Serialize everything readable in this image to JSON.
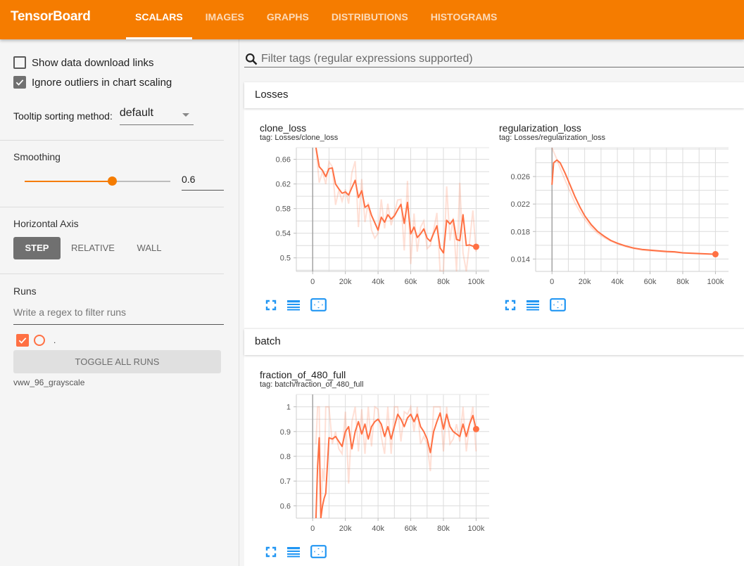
{
  "header": {
    "brand": "TensorBoard",
    "tabs": [
      {
        "label": "SCALARS",
        "active": true
      },
      {
        "label": "IMAGES",
        "active": false
      },
      {
        "label": "GRAPHS",
        "active": false
      },
      {
        "label": "DISTRIBUTIONS",
        "active": false
      },
      {
        "label": "HISTOGRAMS",
        "active": false
      }
    ]
  },
  "sidebar": {
    "show_download_links": {
      "label": "Show data download links",
      "checked": false
    },
    "ignore_outliers": {
      "label": "Ignore outliers in chart scaling",
      "checked": true
    },
    "tooltip_sorting": {
      "label": "Tooltip sorting method:",
      "value": "default"
    },
    "smoothing": {
      "label": "Smoothing",
      "value": "0.6",
      "fraction": 0.6
    },
    "horizontal_axis": {
      "label": "Horizontal Axis",
      "options": [
        {
          "label": "STEP",
          "active": true
        },
        {
          "label": "RELATIVE",
          "active": false
        },
        {
          "label": "WALL",
          "active": false
        }
      ]
    },
    "runs": {
      "label": "Runs",
      "filter_placeholder": "Write a regex to filter runs",
      "items": [
        {
          "name": ".",
          "checked": true,
          "color": "#ff7043"
        }
      ],
      "toggle_all_label": "TOGGLE ALL RUNS",
      "log_dir": "vww_96_grayscale"
    }
  },
  "main": {
    "filter_placeholder": "Filter tags (regular expressions supported)",
    "groups": [
      {
        "name": "Losses"
      },
      {
        "name": "batch"
      }
    ],
    "icons": [
      "fit-to-screen-icon",
      "data-series-list-icon",
      "zoom-reset-icon"
    ]
  },
  "colors": {
    "accent": "#f57c00",
    "run": "#ff7043",
    "icon_blue": "#2196f3"
  },
  "chart_data": [
    {
      "type": "line",
      "title": "clone_loss",
      "tag": "tag: Losses/clone_loss",
      "xlabel": "",
      "ylabel": "",
      "xlim": [
        -10000,
        108000
      ],
      "ylim": [
        0.478,
        0.679
      ],
      "xticks": [
        0,
        20000,
        40000,
        60000,
        80000,
        100000
      ],
      "xtick_labels": [
        "0",
        "20k",
        "40k",
        "60k",
        "80k",
        "100k"
      ],
      "yticks": [
        0.5,
        0.54,
        0.58,
        0.62,
        0.66
      ],
      "ytick_labels": [
        "0.5",
        "0.54",
        "0.58",
        "0.62",
        "0.66"
      ],
      "x_grid_step": 10000,
      "y_grid_step": 0.02,
      "grid": true,
      "series": [
        {
          "name": ".",
          "smoothed": true,
          "x": [
            2000,
            4000,
            6000,
            8000,
            10000,
            12000,
            14000,
            16000,
            18000,
            20000,
            22000,
            24000,
            26000,
            28000,
            30000,
            32000,
            34000,
            36000,
            38000,
            40000,
            42000,
            44000,
            46000,
            48000,
            50000,
            52000,
            54000,
            56000,
            58000,
            60000,
            62000,
            64000,
            66000,
            68000,
            70000,
            72000,
            74000,
            76000,
            78000,
            80000,
            82000,
            84000,
            86000,
            88000,
            90000,
            92000,
            94000,
            96000,
            98000,
            100000
          ],
          "values": [
            0.679,
            0.648,
            0.642,
            0.632,
            0.645,
            0.646,
            0.62,
            0.612,
            0.605,
            0.607,
            0.602,
            0.614,
            0.626,
            0.598,
            0.609,
            0.582,
            0.586,
            0.569,
            0.557,
            0.545,
            0.566,
            0.558,
            0.57,
            0.563,
            0.568,
            0.578,
            0.587,
            0.556,
            0.59,
            0.539,
            0.55,
            0.533,
            0.539,
            0.547,
            0.532,
            0.527,
            0.54,
            0.552,
            0.516,
            0.508,
            0.561,
            0.555,
            0.562,
            0.53,
            0.528,
            0.57,
            0.52,
            0.521,
            0.519,
            0.518
          ]
        },
        {
          "name": ". (raw)",
          "smoothed": false,
          "x": [
            2000,
            4000,
            6000,
            8000,
            10000,
            12000,
            14000,
            16000,
            18000,
            20000,
            22000,
            24000,
            26000,
            28000,
            30000,
            32000,
            34000,
            36000,
            38000,
            40000,
            42000,
            44000,
            46000,
            48000,
            50000,
            52000,
            54000,
            56000,
            58000,
            60000,
            62000,
            64000,
            66000,
            68000,
            70000,
            72000,
            74000,
            76000,
            78000,
            80000,
            82000,
            84000,
            86000,
            88000,
            90000,
            92000,
            94000,
            96000,
            98000,
            100000
          ],
          "values": [
            0.679,
            0.622,
            0.64,
            0.62,
            0.656,
            0.648,
            0.586,
            0.61,
            0.592,
            0.611,
            0.588,
            0.638,
            0.657,
            0.55,
            0.628,
            0.558,
            0.59,
            0.545,
            0.532,
            0.54,
            0.595,
            0.548,
            0.588,
            0.553,
            0.573,
            0.594,
            0.595,
            0.512,
            0.625,
            0.49,
            0.572,
            0.51,
            0.55,
            0.56,
            0.515,
            0.52,
            0.545,
            0.573,
            0.478,
            0.478,
            0.616,
            0.528,
            0.565,
            0.478,
            0.622,
            0.508,
            0.478,
            0.525,
            0.577,
            0.51
          ]
        }
      ]
    },
    {
      "type": "line",
      "title": "regularization_loss",
      "tag": "tag: Losses/regularization_loss",
      "xlabel": "",
      "ylabel": "",
      "xlim": [
        -10000,
        108000
      ],
      "ylim": [
        0.0122,
        0.0302
      ],
      "xticks": [
        0,
        20000,
        40000,
        60000,
        80000,
        100000
      ],
      "xtick_labels": [
        "0",
        "20k",
        "40k",
        "60k",
        "80k",
        "100k"
      ],
      "yticks": [
        0.014,
        0.018,
        0.022,
        0.026
      ],
      "ytick_labels": [
        "0.014",
        "0.018",
        "0.022",
        "0.026"
      ],
      "x_grid_step": 10000,
      "y_grid_step": 0.002,
      "grid": true,
      "series": [
        {
          "name": ".",
          "smoothed": true,
          "x": [
            0,
            1000,
            3000,
            5000,
            8000,
            11000,
            14000,
            17000,
            20000,
            24000,
            28000,
            32000,
            36000,
            40000,
            45000,
            50000,
            55000,
            60000,
            65000,
            70000,
            75000,
            80000,
            85000,
            90000,
            95000,
            100000
          ],
          "values": [
            0.0248,
            0.028,
            0.0284,
            0.028,
            0.0265,
            0.0248,
            0.0231,
            0.0216,
            0.0203,
            0.019,
            0.018,
            0.0173,
            0.0167,
            0.0163,
            0.0159,
            0.0156,
            0.0154,
            0.0153,
            0.0152,
            0.0151,
            0.01505,
            0.0149,
            0.01485,
            0.0148,
            0.01475,
            0.0147
          ]
        },
        {
          "name": ". (raw)",
          "smoothed": false,
          "x": [
            0,
            1000,
            3000,
            5000,
            8000,
            11000,
            14000,
            17000,
            20000,
            24000,
            28000,
            32000,
            36000,
            40000,
            45000,
            50000,
            55000,
            60000,
            65000,
            70000,
            75000,
            80000,
            85000,
            90000,
            95000,
            100000
          ],
          "values": [
            0.0302,
            0.0296,
            0.0285,
            0.0272,
            0.0255,
            0.0238,
            0.0222,
            0.0209,
            0.0198,
            0.0186,
            0.0177,
            0.0171,
            0.0166,
            0.0162,
            0.0158,
            0.0155,
            0.0153,
            0.0152,
            0.0151,
            0.015,
            0.01495,
            0.0149,
            0.01482,
            0.01476,
            0.01472,
            0.0147
          ]
        }
      ]
    },
    {
      "type": "line",
      "title": "fraction_of_480_full",
      "tag": "tag: batch/fraction_of_480_full",
      "xlabel": "",
      "ylabel": "",
      "xlim": [
        -10000,
        108000
      ],
      "ylim": [
        0.55,
        1.05
      ],
      "xticks": [
        0,
        20000,
        40000,
        60000,
        80000,
        100000
      ],
      "xtick_labels": [
        "0",
        "20k",
        "40k",
        "60k",
        "80k",
        "100k"
      ],
      "yticks": [
        0.6,
        0.7,
        0.8,
        0.9,
        1
      ],
      "ytick_labels": [
        "0.6",
        "0.7",
        "0.8",
        "0.9",
        "1"
      ],
      "x_grid_step": 10000,
      "y_grid_step": 0.05,
      "grid": true,
      "series": [
        {
          "name": ".",
          "smoothed": true,
          "x": [
            2000,
            3000,
            4000,
            5000,
            6000,
            7000,
            8000,
            10000,
            12000,
            14000,
            16000,
            18000,
            20000,
            22000,
            24000,
            26000,
            28000,
            30000,
            32000,
            34000,
            36000,
            38000,
            40000,
            42000,
            44000,
            46000,
            48000,
            50000,
            52000,
            54000,
            56000,
            58000,
            60000,
            62000,
            64000,
            66000,
            68000,
            70000,
            72000,
            74000,
            76000,
            78000,
            80000,
            82000,
            84000,
            86000,
            88000,
            90000,
            92000,
            94000,
            96000,
            98000,
            100000
          ],
          "values": [
            0.55,
            0.76,
            0.875,
            0.55,
            0.6,
            0.63,
            0.65,
            0.875,
            0.87,
            0.88,
            0.86,
            0.84,
            0.9,
            0.92,
            0.83,
            0.9,
            0.94,
            0.89,
            0.93,
            0.87,
            0.92,
            0.94,
            0.95,
            0.93,
            0.88,
            0.92,
            0.87,
            0.92,
            0.97,
            0.95,
            0.92,
            0.955,
            0.97,
            0.94,
            0.97,
            0.92,
            0.9,
            0.87,
            0.815,
            0.9,
            0.94,
            0.975,
            0.91,
            0.97,
            0.92,
            0.9,
            0.89,
            0.88,
            0.93,
            0.88,
            0.93,
            0.965,
            0.91
          ]
        },
        {
          "name": ". (raw)",
          "smoothed": false,
          "x": [
            2000,
            3000,
            4000,
            5000,
            6000,
            7000,
            8000,
            10000,
            12000,
            14000,
            16000,
            18000,
            20000,
            22000,
            24000,
            26000,
            28000,
            30000,
            32000,
            34000,
            36000,
            38000,
            40000,
            42000,
            44000,
            46000,
            48000,
            50000,
            52000,
            54000,
            56000,
            58000,
            60000,
            62000,
            64000,
            66000,
            68000,
            70000,
            72000,
            74000,
            76000,
            78000,
            80000,
            82000,
            84000,
            86000,
            88000,
            90000,
            92000,
            94000,
            96000,
            98000,
            100000
          ],
          "values": [
            0.85,
            1.0,
            1.0,
            0.55,
            0.75,
            0.7,
            1.0,
            1.0,
            0.85,
            0.9,
            0.83,
            0.81,
            0.98,
            0.69,
            0.94,
            1.0,
            0.82,
            0.99,
            0.81,
            1.0,
            0.84,
            1.0,
            0.99,
            0.88,
            0.81,
            1.0,
            0.81,
            1.0,
            1.0,
            0.86,
            0.98,
            0.97,
            1.0,
            0.9,
            1.0,
            0.85,
            0.88,
            0.85,
            0.74,
            1.0,
            1.0,
            1.0,
            0.82,
            1.0,
            0.85,
            0.87,
            0.93,
            0.86,
            1.0,
            0.82,
            0.93,
            1.0,
            0.82
          ]
        }
      ]
    }
  ]
}
